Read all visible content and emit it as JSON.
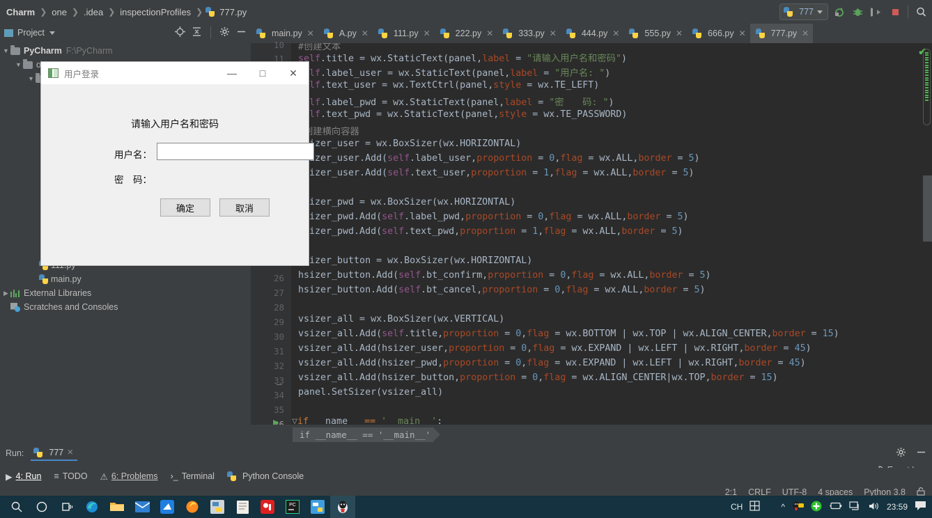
{
  "titlebar": {
    "breadcrumbs": [
      "Charm",
      "one",
      ".idea",
      "inspectionProfiles",
      "777.py"
    ],
    "run_config": "777",
    "icons": [
      "rerun-icon",
      "debug-icon",
      "coverage-icon",
      "stop-icon",
      "search-icon"
    ]
  },
  "project_panel": {
    "title": "Project",
    "tree": [
      {
        "label": "PyCharm",
        "path": "F:\\PyCharm",
        "type": "folder",
        "depth": 0,
        "expanded": true
      },
      {
        "label": "one",
        "path": "",
        "type": "folder",
        "depth": 1,
        "expanded": true
      },
      {
        "label": "111.py",
        "path": "",
        "type": "python",
        "depth": 3
      },
      {
        "label": "main.py",
        "path": "",
        "type": "python",
        "depth": 3
      },
      {
        "label": "External Libraries",
        "path": "",
        "type": "library",
        "depth": 0
      },
      {
        "label": "Scratches and Consoles",
        "path": "",
        "type": "scratch",
        "depth": 0
      }
    ]
  },
  "editor": {
    "tabs": [
      {
        "label": "main.py",
        "active": false
      },
      {
        "label": "A.py",
        "active": false
      },
      {
        "label": "111.py",
        "active": false
      },
      {
        "label": "222.py",
        "active": false
      },
      {
        "label": "333.py",
        "active": false
      },
      {
        "label": "444.py",
        "active": false
      },
      {
        "label": "555.py",
        "active": false
      },
      {
        "label": "666.py",
        "active": false
      },
      {
        "label": "777.py",
        "active": true
      }
    ],
    "line_numbers_top": [
      "10",
      "11"
    ],
    "line_numbers_bottom": [
      "26",
      "27",
      "28",
      "29",
      "30",
      "31",
      "32",
      "33",
      "34",
      "35",
      "36"
    ],
    "breadcrumb": "if __name__ == '__main__'",
    "code_lines": [
      "#创建文本",
      "self.title = wx.StaticText(panel,label = \"请输入用户名和密码\")",
      "self.label_user = wx.StaticText(panel,label = \"用户名: \")",
      "self.text_user = wx.TextCtrl(panel,style = wx.TE_LEFT)",
      "self.label_pwd = wx.StaticText(panel,label = \"密    码: \")",
      "self.text_pwd = wx.StaticText(panel,style = wx.TE_PASSWORD)",
      "#创建横向容器",
      "hsizer_user = wx.BoxSizer(wx.HORIZONTAL)",
      "hsizer_user.Add(self.label_user,proportion = 0,flag = wx.ALL,border = 5)",
      "hsizer_user.Add(self.text_user,proportion = 1,flag = wx.ALL,border = 5)",
      "",
      "hsizer_pwd = wx.BoxSizer(wx.HORIZONTAL)",
      "hsizer_pwd.Add(self.label_pwd,proportion = 0,flag = wx.ALL,border = 5)",
      "hsizer_pwd.Add(self.text_pwd,proportion = 1,flag = wx.ALL,border = 5)",
      "",
      "hsizer_button = wx.BoxSizer(wx.HORIZONTAL)",
      "hsizer_button.Add(self.bt_confirm,proportion = 0,flag = wx.ALL,border = 5)",
      "hsizer_button.Add(self.bt_cancel,proportion = 0,flag = wx.ALL,border = 5)",
      "",
      "vsizer_all = wx.BoxSizer(wx.VERTICAL)",
      "vsizer_all.Add(self.title,proportion = 0,flag = wx.BOTTOM | wx.TOP | wx.ALIGN_CENTER,border = 15)",
      "vsizer_all.Add(hsizer_user,proportion = 0,flag = wx.EXPAND | wx.LEFT | wx.RIGHT,border = 45)",
      "vsizer_all.Add(hsizer_pwd,proportion = 0,flag = wx.EXPAND | wx.LEFT | wx.RIGHT,border = 45)",
      "vsizer_all.Add(hsizer_button,proportion = 0,flag = wx.ALIGN_CENTER|wx.TOP,border = 15)",
      "panel.SetSizer(vsizer_all)",
      "",
      "if __name__ == '__main__':"
    ]
  },
  "dialog": {
    "title": "用户登录",
    "heading": "请输入用户名和密码",
    "label_user": "用户名：",
    "label_pwd": "密　码：",
    "input_user_value": "",
    "button_ok": "确定",
    "button_cancel": "取消",
    "minimize": "—",
    "maximize": "□",
    "close": "✕"
  },
  "run_panel": {
    "label": "Run:",
    "tab": "777"
  },
  "tool_strip": [
    {
      "label": "4: Run",
      "active": true
    },
    {
      "label": "TODO",
      "active": false
    },
    {
      "label": "6: Problems",
      "active": false
    },
    {
      "label": "Terminal",
      "active": false
    },
    {
      "label": "Python Console",
      "active": false
    }
  ],
  "event_log": "Event Log",
  "statusbar": {
    "caret": "2:1",
    "line_sep": "CRLF",
    "encoding": "UTF-8",
    "indent": "4 spaces",
    "interpreter": "Python 3.8"
  },
  "taskbar": {
    "ime": "CH",
    "clock": "23:59"
  },
  "colors": {
    "accent_blue": "#4a88c7",
    "ide_bg": "#3c3f41",
    "editor_bg": "#2b2b2b",
    "ok_green": "#5ab85a"
  }
}
